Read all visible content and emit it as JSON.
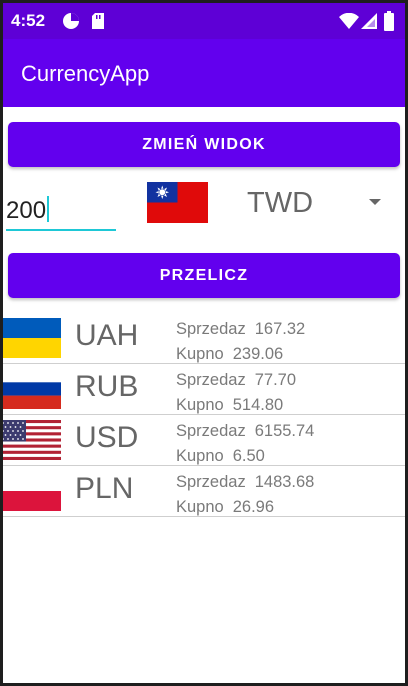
{
  "status_bar": {
    "time": "4:52"
  },
  "app": {
    "title": "CurrencyApp"
  },
  "actions": {
    "switch_view_label": "ZMIEŃ WIDOK",
    "convert_label": "PRZELICZ"
  },
  "converter": {
    "amount": "200",
    "selected_currency": "TWD",
    "selected_flag": "taiwan-flag"
  },
  "labels": {
    "sell": "Sprzedaz",
    "buy": "Kupno"
  },
  "rates": [
    {
      "code": "UAH",
      "flag": "ukraine-flag",
      "sell": "167.32",
      "buy": "239.06"
    },
    {
      "code": "RUB",
      "flag": "russia-flag",
      "sell": "77.70",
      "buy": "514.80"
    },
    {
      "code": "USD",
      "flag": "usa-flag",
      "sell": "6155.74",
      "buy": "6.50"
    },
    {
      "code": "PLN",
      "flag": "poland-flag",
      "sell": "1483.68",
      "buy": "26.96"
    }
  ],
  "colors": {
    "primary": "#6200ee",
    "primary_dark": "#5e00d6",
    "accent": "#1ec8d6"
  }
}
